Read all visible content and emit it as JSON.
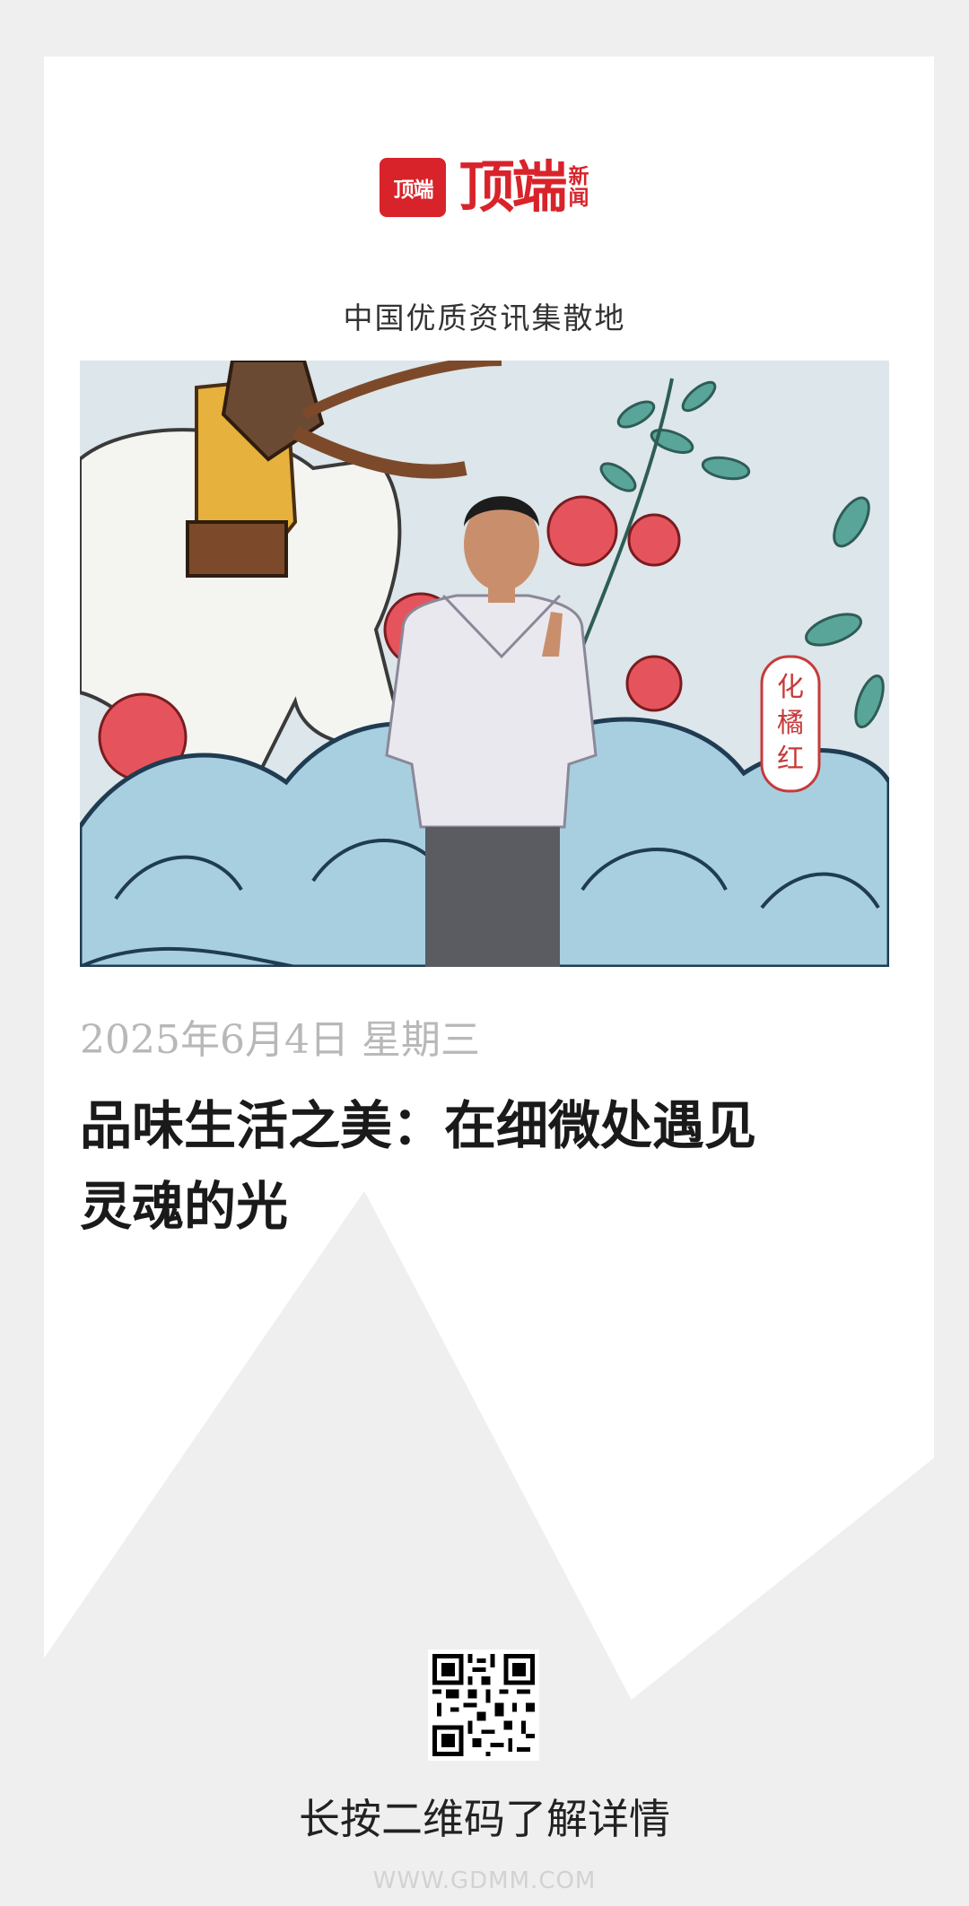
{
  "brand": {
    "badge_text": "顶端",
    "name": "顶端",
    "sub_line1": "新",
    "sub_line2": "闻",
    "tagline": "中国优质资讯集散地",
    "color": "#d8232a"
  },
  "hero": {
    "mural_label_line1": "化",
    "mural_label_line2": "橘",
    "mural_label_line3": "红"
  },
  "article": {
    "date": "2025年6月4日 星期三",
    "title_line1": "品味生活之美：在细微处遇见",
    "title_line2": "灵魂的光"
  },
  "footer": {
    "qr_hint": "长按二维码了解详情",
    "watermark": "WWW.GDMM.COM"
  }
}
